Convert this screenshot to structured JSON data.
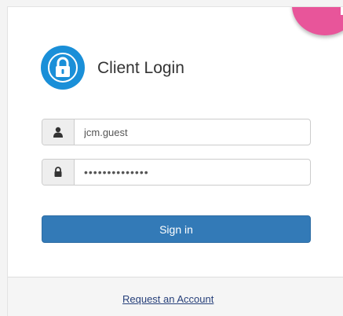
{
  "login": {
    "title": "Client Login",
    "username_value": "jcm.guest",
    "password_value": "••••••••••••••",
    "signin_label": "Sign in",
    "request_account_label": "Request an Account"
  },
  "icons": {
    "lock": "lock-icon",
    "user": "user-icon",
    "password_lock": "lock-icon"
  },
  "colors": {
    "accent_blue": "#1a8fd8",
    "button_blue": "#337ab7",
    "badge_pink": "#e8559a",
    "link": "#27407a"
  }
}
